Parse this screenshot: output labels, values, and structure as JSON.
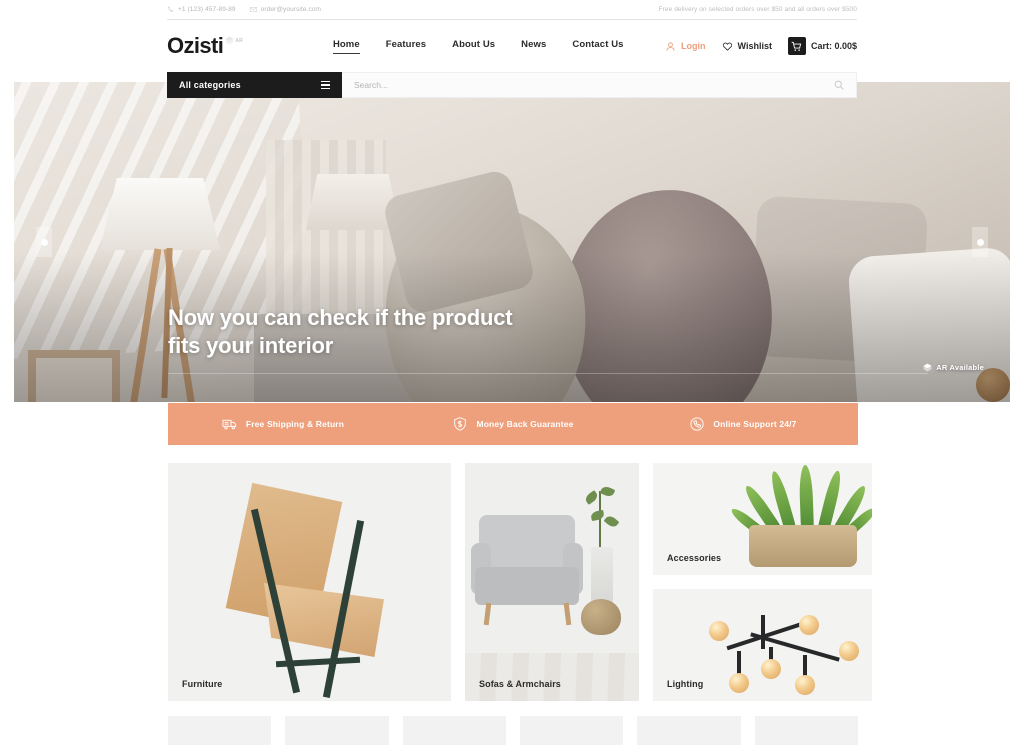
{
  "topbar": {
    "phone": "+1 (123) 457-89-89",
    "email": "order@yoursite.com",
    "delivery_notice": "Free delivery on selected orders over $50 and all orders over $500",
    "phone_icon": "phone-icon",
    "email_icon": "envelope-icon"
  },
  "header": {
    "logo_text": "Ozisti",
    "logo_badge": "AR",
    "nav": [
      {
        "label": "Home",
        "active": true
      },
      {
        "label": "Features",
        "active": false
      },
      {
        "label": "About Us",
        "active": false
      },
      {
        "label": "News",
        "active": false
      },
      {
        "label": "Contact Us",
        "active": false
      }
    ],
    "login_label": "Login",
    "wishlist_label": "Wishlist",
    "cart_label": "Cart: 0.00$",
    "login_color": "#ef9e7d"
  },
  "search": {
    "category_label": "All categories",
    "placeholder": "Search...",
    "value": ""
  },
  "hero": {
    "title_line1": "Now you can check if the product",
    "title_line2": "fits your interior",
    "ar_badge": "AR Available",
    "prev_label": "Previous slide",
    "next_label": "Next slide"
  },
  "features": {
    "accent_color": "#ee9f7c",
    "items": [
      {
        "icon": "truck-icon",
        "label": "Free Shipping & Return"
      },
      {
        "icon": "shield-dollar-icon",
        "label": "Money Back Guarantee"
      },
      {
        "icon": "headset-phone-icon",
        "label": "Online Support 24/7"
      }
    ]
  },
  "categories": {
    "furniture": "Furniture",
    "sofas": "Sofas & Armchairs",
    "accessories": "Accessories",
    "lighting": "Lighting"
  },
  "brands": {
    "count": 6
  }
}
